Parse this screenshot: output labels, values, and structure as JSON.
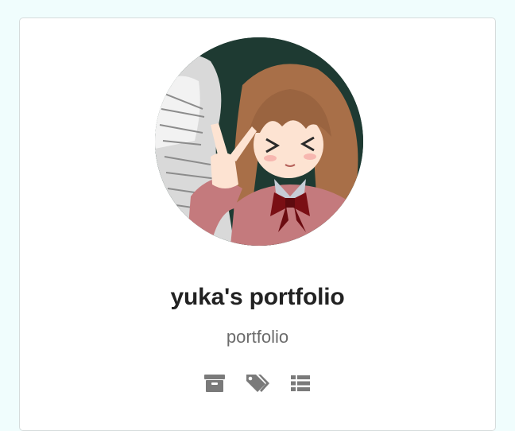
{
  "profile": {
    "title": "yuka's portfolio",
    "subtitle": "portfolio",
    "avatar_alt": "anime girl avatar making peace sign"
  },
  "icons": [
    {
      "name": "archive-icon"
    },
    {
      "name": "tags-icon"
    },
    {
      "name": "list-icon"
    }
  ],
  "colors": {
    "page_background": "#f0fdfd",
    "card_background": "#ffffff",
    "title": "#222222",
    "subtitle": "#6b6b6b",
    "icon": "#7a7a7a"
  }
}
